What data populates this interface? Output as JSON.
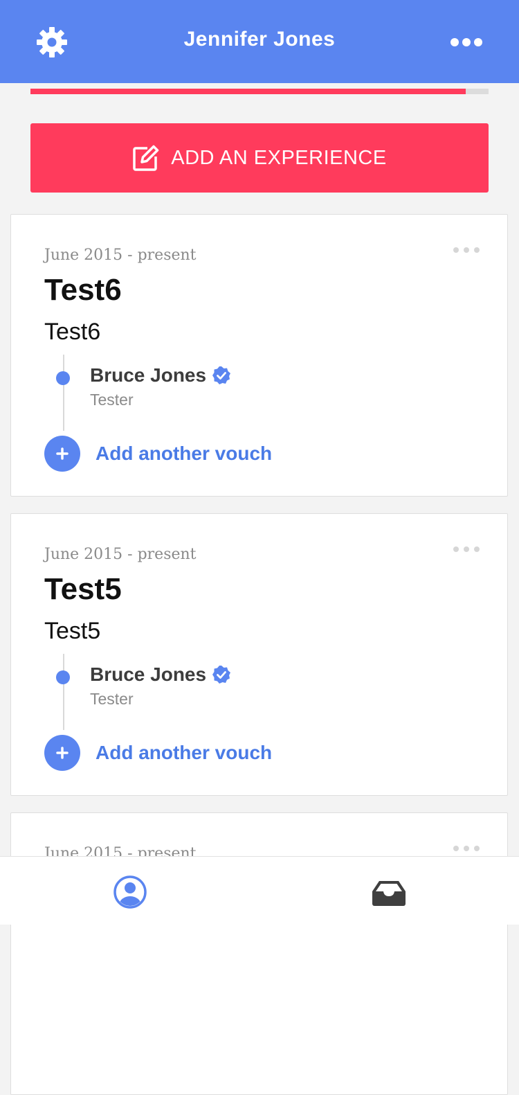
{
  "header": {
    "title": "Jennifer Jones",
    "settings_icon": "gear-icon",
    "more_icon": "more-dots-icon"
  },
  "progress": {
    "value_percent": 95
  },
  "add_experience": {
    "label": "ADD AN EXPERIENCE",
    "icon": "edit-icon"
  },
  "experiences": [
    {
      "date": "June 2015 - present",
      "title": "Test6",
      "subtitle": "Test6",
      "vouch": {
        "name": "Bruce Jones",
        "role": "Tester",
        "verified": true
      },
      "add_vouch_label": "Add another vouch"
    },
    {
      "date": "June 2015 - present",
      "title": "Test5",
      "subtitle": "Test5",
      "vouch": {
        "name": "Bruce Jones",
        "role": "Tester",
        "verified": true
      },
      "add_vouch_label": "Add another vouch"
    },
    {
      "date": "June 2015 - present"
    }
  ],
  "tabbar": {
    "profile_icon": "profile-icon",
    "inbox_icon": "inbox-icon"
  },
  "colors": {
    "header": "#5a85f0",
    "accent": "#ff3b5c",
    "link": "#4a7be6",
    "background": "#f3f3f3"
  }
}
